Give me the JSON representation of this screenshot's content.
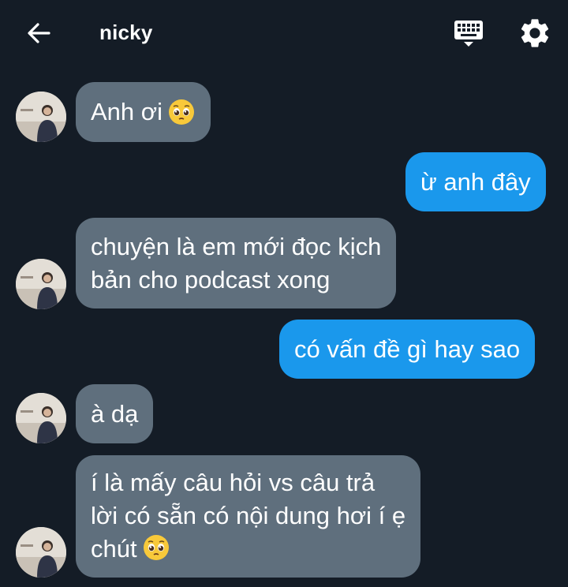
{
  "header": {
    "back_icon": "arrow-left-icon",
    "contact_name": "nicky",
    "keyboard_icon": "keyboard-icon",
    "settings_icon": "gear-icon"
  },
  "colors": {
    "background": "#141c26",
    "incoming_bubble": "#5f6f7d",
    "outgoing_bubble": "#1a98ec",
    "text": "#ffffff"
  },
  "messages": [
    {
      "sender": "nicky",
      "direction": "incoming",
      "text": "Anh ơi",
      "emoji": "pleading-face-icon"
    },
    {
      "sender": "me",
      "direction": "outgoing",
      "text": "ừ anh đây"
    },
    {
      "sender": "nicky",
      "direction": "incoming",
      "text": "chuyện là em mới đọc kịch\nbản cho podcast xong"
    },
    {
      "sender": "me",
      "direction": "outgoing",
      "text": "có vấn đề gì hay sao"
    },
    {
      "sender": "nicky",
      "direction": "incoming",
      "text": "à dạ"
    },
    {
      "sender": "nicky",
      "direction": "incoming",
      "text": "í là mấy câu hỏi vs câu trả\nlời có sẵn có nội dung hơi í ẹ\nchút",
      "emoji": "pleading-face-icon"
    }
  ]
}
